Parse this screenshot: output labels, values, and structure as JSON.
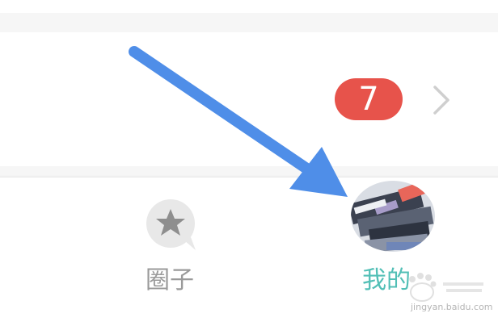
{
  "notification": {
    "badge_count": "7",
    "badge_color": "#e7534b",
    "chevron_icon": "chevron-right-icon"
  },
  "tabbar": {
    "tabs": [
      {
        "label": "圈子",
        "icon": "star-bubble-icon",
        "active": false,
        "color": "#9a9a9a"
      },
      {
        "label": "我的",
        "icon": "avatar",
        "active": true,
        "color": "#52bfb6"
      }
    ]
  },
  "annotation": {
    "arrow_color": "#4f8ee8",
    "arrow_icon": "pointer-arrow-icon"
  },
  "watermark": {
    "text": "jingyan.baidu.com"
  }
}
